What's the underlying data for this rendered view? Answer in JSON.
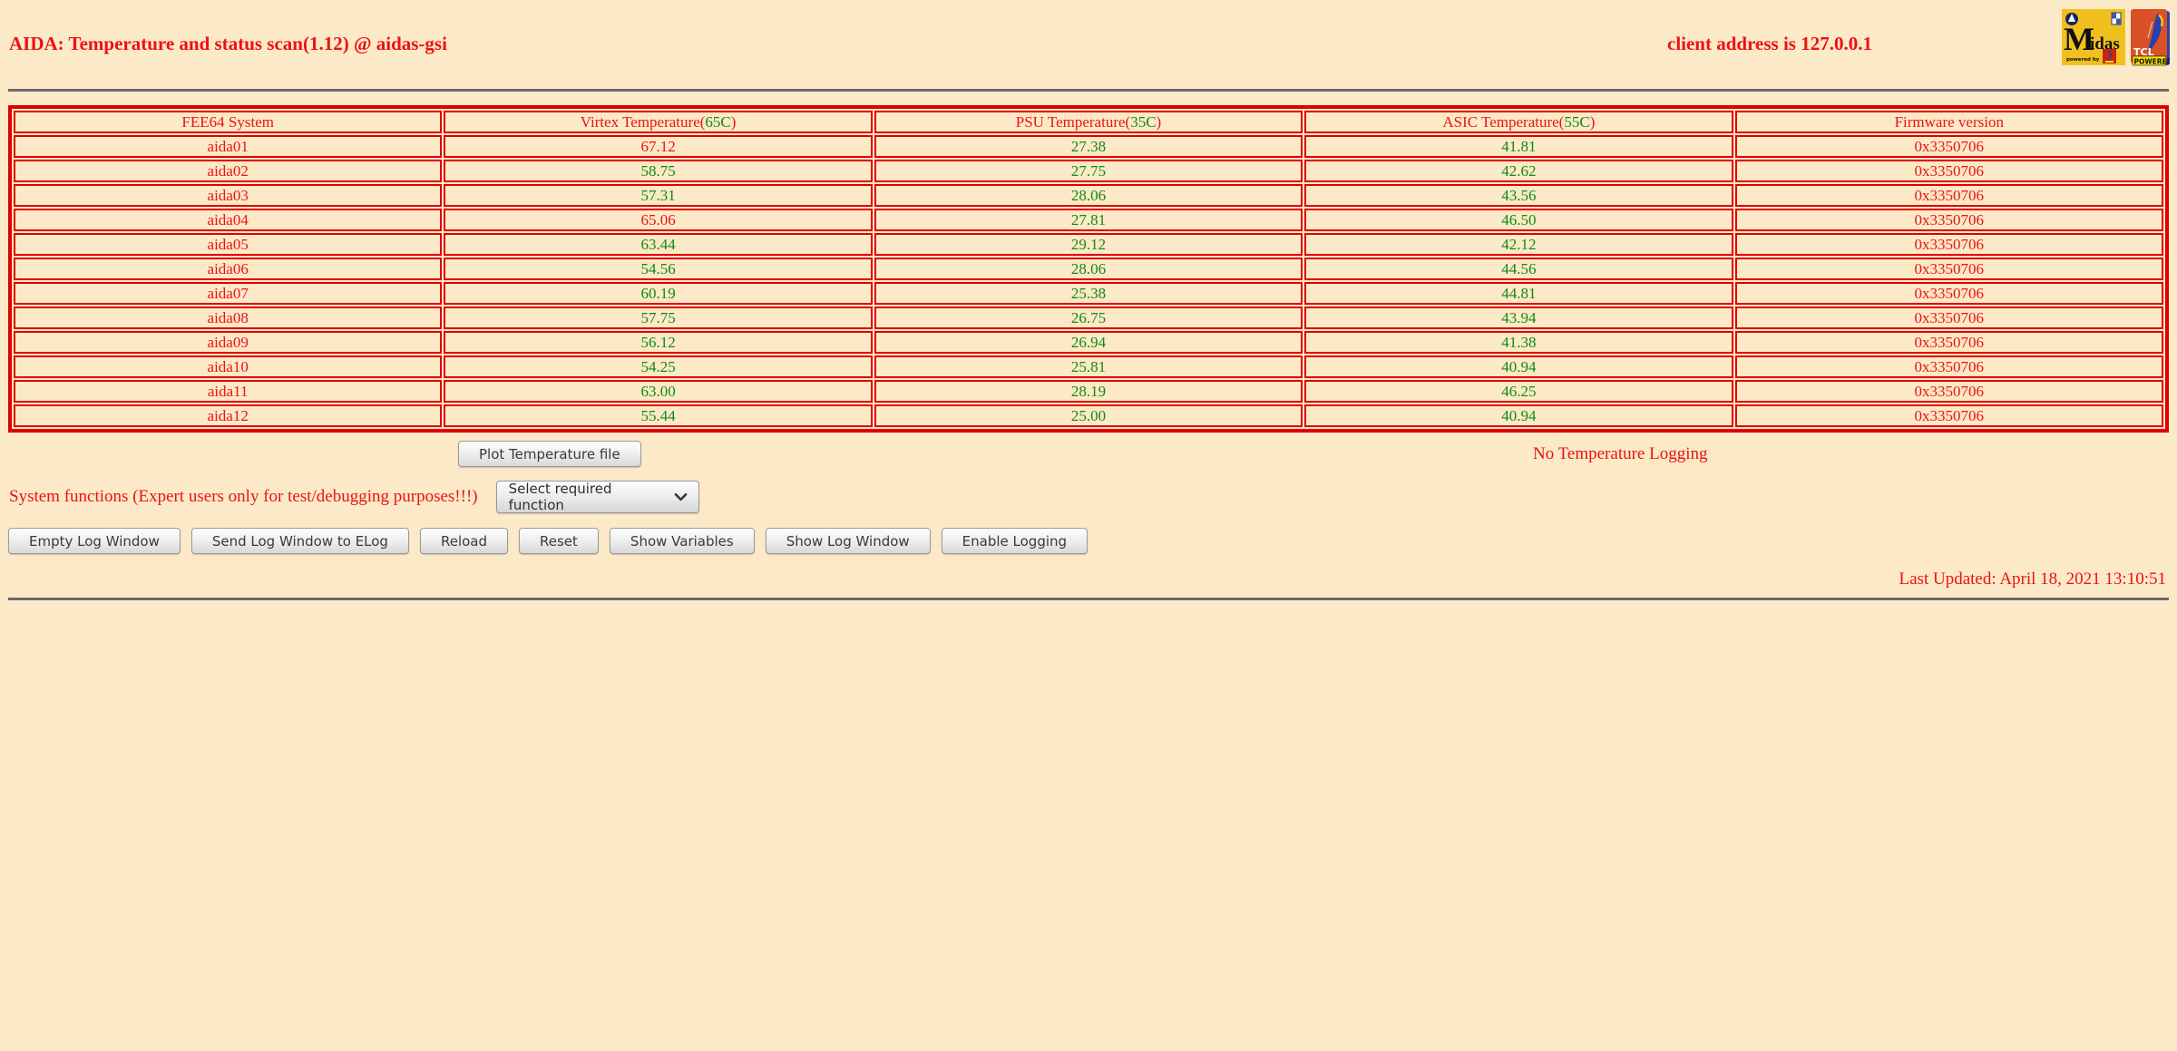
{
  "page": {
    "title": "AIDA: Temperature and status scan(1.12) @ aidas-gsi",
    "client_address": "client address is 127.0.0.1",
    "no_logging_status": "No Temperature Logging",
    "system_functions_label": "System functions (Expert users only for test/debugging purposes!!!)",
    "last_updated": "Last Updated: April 18, 2021 13:10:51"
  },
  "logos": {
    "midas": {
      "letter": "M",
      "rest": "idas",
      "powered_by": "powered by"
    },
    "tcl": {
      "name": "TCL",
      "powered": "POWERED"
    }
  },
  "table": {
    "columns": [
      {
        "prefix": "FEE64 System",
        "threshold": "",
        "suffix": ""
      },
      {
        "prefix": "Virtex Temperature(",
        "threshold": "65C",
        "suffix": ")"
      },
      {
        "prefix": "PSU Temperature(",
        "threshold": "35C",
        "suffix": ")"
      },
      {
        "prefix": "ASIC Temperature(",
        "threshold": "55C",
        "suffix": ")"
      },
      {
        "prefix": "Firmware version",
        "threshold": "",
        "suffix": ""
      }
    ],
    "rows": [
      {
        "name": "aida01",
        "virtex": "67.12",
        "virtex_status": "alarm",
        "psu": "27.38",
        "psu_status": "ok",
        "asic": "41.81",
        "asic_status": "ok",
        "firmware": "0x3350706"
      },
      {
        "name": "aida02",
        "virtex": "58.75",
        "virtex_status": "ok",
        "psu": "27.75",
        "psu_status": "ok",
        "asic": "42.62",
        "asic_status": "ok",
        "firmware": "0x3350706"
      },
      {
        "name": "aida03",
        "virtex": "57.31",
        "virtex_status": "ok",
        "psu": "28.06",
        "psu_status": "ok",
        "asic": "43.56",
        "asic_status": "ok",
        "firmware": "0x3350706"
      },
      {
        "name": "aida04",
        "virtex": "65.06",
        "virtex_status": "alarm",
        "psu": "27.81",
        "psu_status": "ok",
        "asic": "46.50",
        "asic_status": "ok",
        "firmware": "0x3350706"
      },
      {
        "name": "aida05",
        "virtex": "63.44",
        "virtex_status": "ok",
        "psu": "29.12",
        "psu_status": "ok",
        "asic": "42.12",
        "asic_status": "ok",
        "firmware": "0x3350706"
      },
      {
        "name": "aida06",
        "virtex": "54.56",
        "virtex_status": "ok",
        "psu": "28.06",
        "psu_status": "ok",
        "asic": "44.56",
        "asic_status": "ok",
        "firmware": "0x3350706"
      },
      {
        "name": "aida07",
        "virtex": "60.19",
        "virtex_status": "ok",
        "psu": "25.38",
        "psu_status": "ok",
        "asic": "44.81",
        "asic_status": "ok",
        "firmware": "0x3350706"
      },
      {
        "name": "aida08",
        "virtex": "57.75",
        "virtex_status": "ok",
        "psu": "26.75",
        "psu_status": "ok",
        "asic": "43.94",
        "asic_status": "ok",
        "firmware": "0x3350706"
      },
      {
        "name": "aida09",
        "virtex": "56.12",
        "virtex_status": "ok",
        "psu": "26.94",
        "psu_status": "ok",
        "asic": "41.38",
        "asic_status": "ok",
        "firmware": "0x3350706"
      },
      {
        "name": "aida10",
        "virtex": "54.25",
        "virtex_status": "ok",
        "psu": "25.81",
        "psu_status": "ok",
        "asic": "40.94",
        "asic_status": "ok",
        "firmware": "0x3350706"
      },
      {
        "name": "aida11",
        "virtex": "63.00",
        "virtex_status": "ok",
        "psu": "28.19",
        "psu_status": "ok",
        "asic": "46.25",
        "asic_status": "ok",
        "firmware": "0x3350706"
      },
      {
        "name": "aida12",
        "virtex": "55.44",
        "virtex_status": "ok",
        "psu": "25.00",
        "psu_status": "ok",
        "asic": "40.94",
        "asic_status": "ok",
        "firmware": "0x3350706"
      }
    ]
  },
  "controls": {
    "plot_button": "Plot Temperature file",
    "function_select": {
      "selected": "Select required function"
    },
    "log_buttons": [
      "Empty Log Window",
      "Send Log Window to ELog",
      "Reload",
      "Reset",
      "Show Variables",
      "Show Log Window",
      "Enable Logging"
    ]
  },
  "colors": {
    "background": "#fce9c8",
    "accent_red": "#ee1111",
    "ok_green": "#0f8c0f",
    "table_border_red": "#e00000",
    "rule_gray": "#6a6a6a"
  }
}
